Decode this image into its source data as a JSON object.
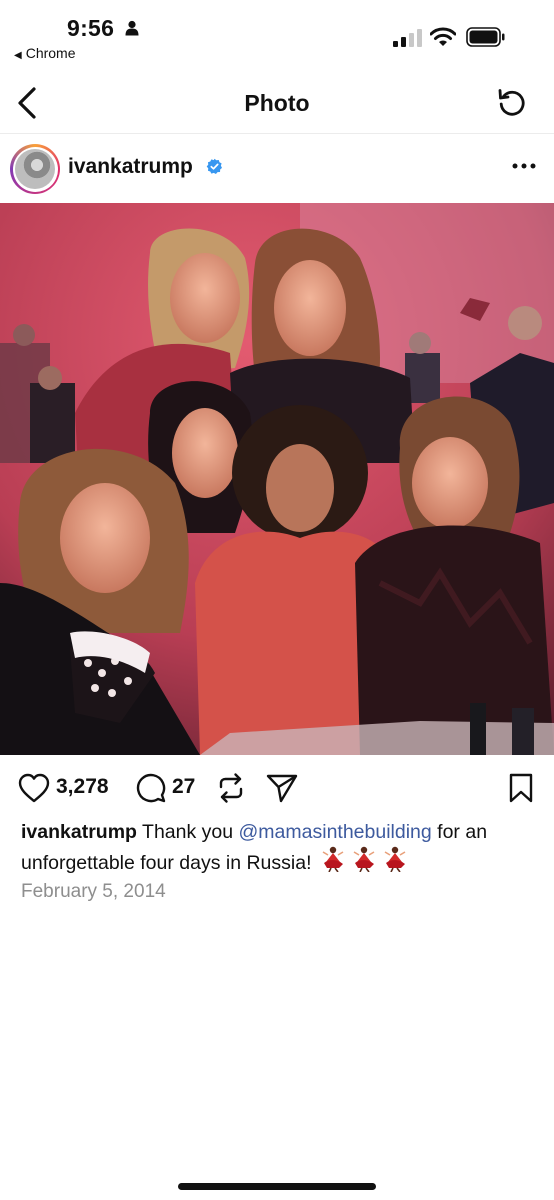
{
  "status_bar": {
    "time": "9:56",
    "back_app": "Chrome"
  },
  "nav": {
    "title": "Photo"
  },
  "post": {
    "username": "ivankatrump",
    "likes": "3,278",
    "comments": "27",
    "caption": {
      "username": "ivankatrump",
      "text_before": "Thank you",
      "mention": "@mamasinthebuilding",
      "text_after": "for an unforgettable four days in Russia!"
    },
    "date": "February 5, 2014"
  },
  "colors": {
    "verified": "#3897f0",
    "mention": "#3d5a9e",
    "date": "#8e8e8e"
  },
  "icons": [
    "person-icon",
    "signal-icon",
    "wifi-icon",
    "battery-icon",
    "back-chevron-icon",
    "refresh-icon",
    "verified-icon",
    "more-icon",
    "heart-icon",
    "comment-icon",
    "repost-icon",
    "share-icon",
    "bookmark-icon",
    "dancer-emoji"
  ]
}
